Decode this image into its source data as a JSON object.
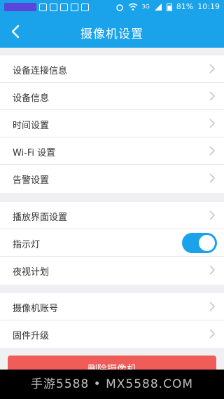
{
  "status_bar": {
    "signal": "3G",
    "battery": "81%",
    "time": "10:19"
  },
  "nav": {
    "title": "摄像机设置"
  },
  "sections": [
    {
      "items": [
        {
          "label": "设备连接信息"
        },
        {
          "label": "设备信息"
        },
        {
          "label": "时间设置"
        },
        {
          "label": "Wi-Fi 设置"
        },
        {
          "label": "告警设置"
        }
      ]
    },
    {
      "items": [
        {
          "label": "播放界面设置"
        },
        {
          "label": "指示灯",
          "toggle": true
        },
        {
          "label": "夜视计划"
        }
      ]
    },
    {
      "items": [
        {
          "label": "摄像机账号"
        },
        {
          "label": "固件升级"
        }
      ]
    }
  ],
  "delete_button": {
    "label": "删除摄像机"
  },
  "watermark": {
    "text": "手游5588 • MX5588.COM"
  },
  "colors": {
    "accent": "#1aa3ea",
    "danger": "#f05c58"
  }
}
